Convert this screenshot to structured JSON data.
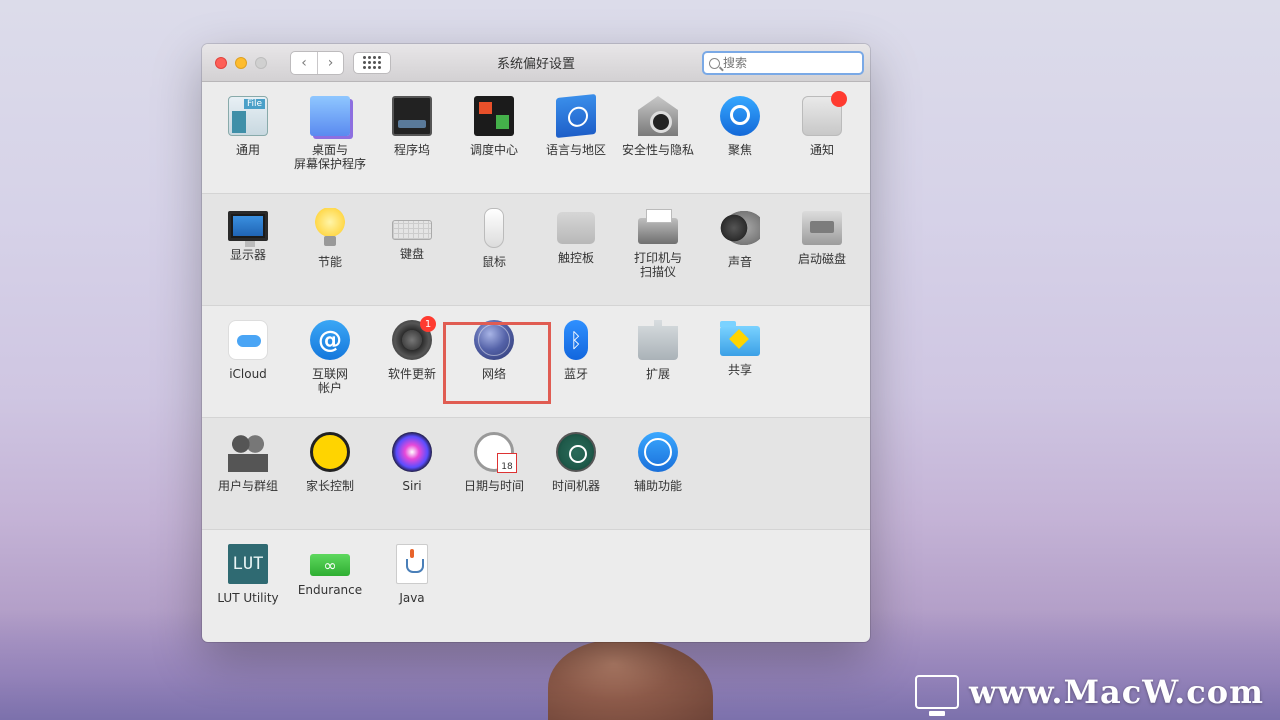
{
  "window": {
    "title": "系统偏好设置",
    "search": {
      "placeholder": "搜索",
      "value": ""
    }
  },
  "sections": [
    {
      "items": [
        {
          "name": "general",
          "label": "通用"
        },
        {
          "name": "desktop-screensaver",
          "label": "桌面与\n屏幕保护程序"
        },
        {
          "name": "dock",
          "label": "程序坞"
        },
        {
          "name": "mission-control",
          "label": "调度中心"
        },
        {
          "name": "language-region",
          "label": "语言与地区"
        },
        {
          "name": "security-privacy",
          "label": "安全性与隐私"
        },
        {
          "name": "spotlight",
          "label": "聚焦"
        },
        {
          "name": "notifications",
          "label": "通知"
        }
      ]
    },
    {
      "items": [
        {
          "name": "displays",
          "label": "显示器"
        },
        {
          "name": "energy-saver",
          "label": "节能"
        },
        {
          "name": "keyboard",
          "label": "键盘"
        },
        {
          "name": "mouse",
          "label": "鼠标"
        },
        {
          "name": "trackpad",
          "label": "触控板"
        },
        {
          "name": "printers-scanners",
          "label": "打印机与\n扫描仪"
        },
        {
          "name": "sound",
          "label": "声音"
        },
        {
          "name": "startup-disk",
          "label": "启动磁盘"
        }
      ]
    },
    {
      "items": [
        {
          "name": "icloud",
          "label": "iCloud"
        },
        {
          "name": "internet-accounts",
          "label": "互联网\n帐户"
        },
        {
          "name": "software-update",
          "label": "软件更新",
          "badge": "1"
        },
        {
          "name": "network",
          "label": "网络",
          "highlighted": true
        },
        {
          "name": "bluetooth",
          "label": "蓝牙"
        },
        {
          "name": "extensions",
          "label": "扩展"
        },
        {
          "name": "sharing",
          "label": "共享"
        }
      ]
    },
    {
      "items": [
        {
          "name": "users-groups",
          "label": "用户与群组"
        },
        {
          "name": "parental-controls",
          "label": "家长控制"
        },
        {
          "name": "siri",
          "label": "Siri"
        },
        {
          "name": "date-time",
          "label": "日期与时间"
        },
        {
          "name": "time-machine",
          "label": "时间机器"
        },
        {
          "name": "accessibility",
          "label": "辅助功能"
        }
      ]
    },
    {
      "items": [
        {
          "name": "lut-utility",
          "label": "LUT Utility"
        },
        {
          "name": "endurance",
          "label": "Endurance"
        },
        {
          "name": "java",
          "label": "Java"
        }
      ]
    }
  ],
  "icon_text": {
    "general": "File",
    "lut": "LUT",
    "endurance": "∞",
    "calendar_day": "18"
  },
  "watermark": {
    "text": "www.MacW.com"
  },
  "colors": {
    "highlight": "#e05c52",
    "search_focus": "#7aa9e6",
    "close": "#fe5f57",
    "minimize": "#febc2e"
  }
}
